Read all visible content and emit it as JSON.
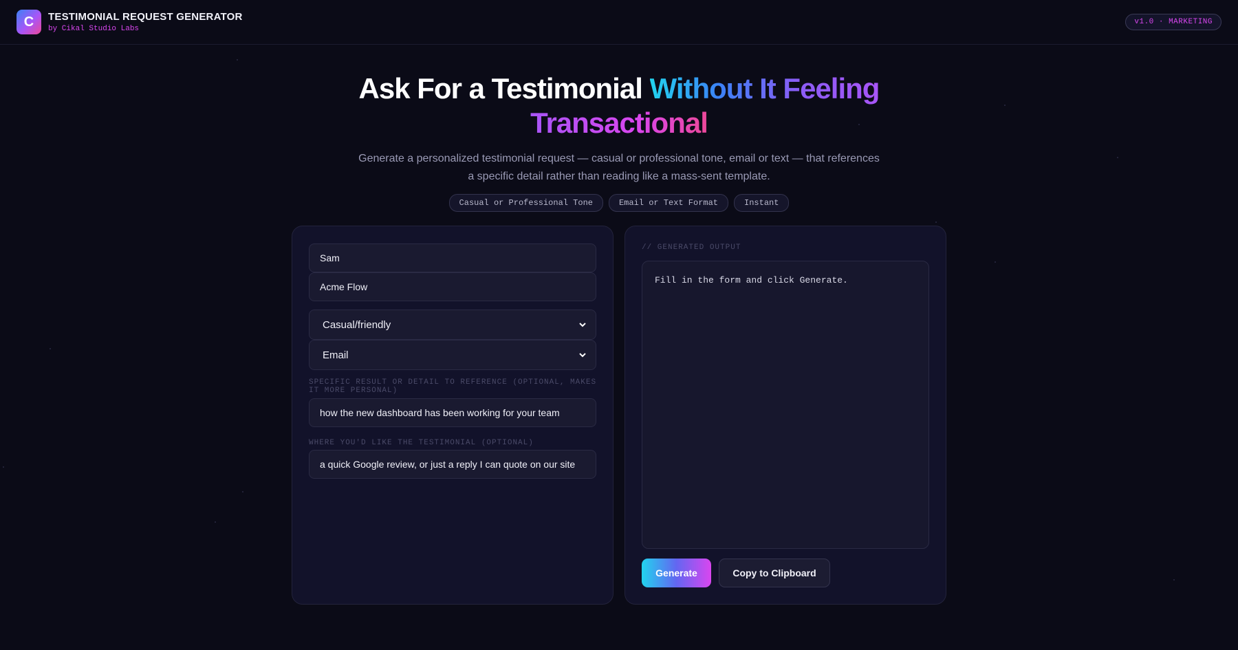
{
  "header": {
    "logo_letter": "C",
    "title": "TESTIMONIAL REQUEST GENERATOR",
    "subtitle": "by Cikal Studio Labs",
    "version_badge": "v1.0 · MARKETING"
  },
  "hero": {
    "title_plain": "Ask For a Testimonial ",
    "title_gradient_1": "Without It Feeling",
    "title_gradient_2": "Transactional",
    "description": "Generate a personalized testimonial request — casual or professional tone, email or text — that references a specific detail rather than reading like a mass-sent template.",
    "tags": [
      "Casual or Professional Tone",
      "Email or Text Format",
      "Instant"
    ]
  },
  "form": {
    "customer_name": "Sam",
    "product_name": "Acme Flow",
    "tone_selected": "Casual/friendly",
    "format_selected": "Email",
    "detail_label": "SPECIFIC RESULT OR DETAIL TO REFERENCE (OPTIONAL, MAKES IT MORE PERSONAL)",
    "detail_value": "how the new dashboard has been working for your team",
    "where_label": "WHERE YOU'D LIKE THE TESTIMONIAL (OPTIONAL)",
    "where_value": "a quick Google review, or just a reply I can quote on our site"
  },
  "output": {
    "label": "// GENERATED OUTPUT",
    "placeholder_text": "Fill in the form and click Generate.",
    "generate_label": "Generate",
    "copy_label": "Copy to Clipboard"
  },
  "colors": {
    "background": "#0b0b17",
    "panel": "#12122a",
    "accent_pink": "#d946ef",
    "accent_cyan": "#22d3ee",
    "accent_purple": "#a855f7"
  }
}
